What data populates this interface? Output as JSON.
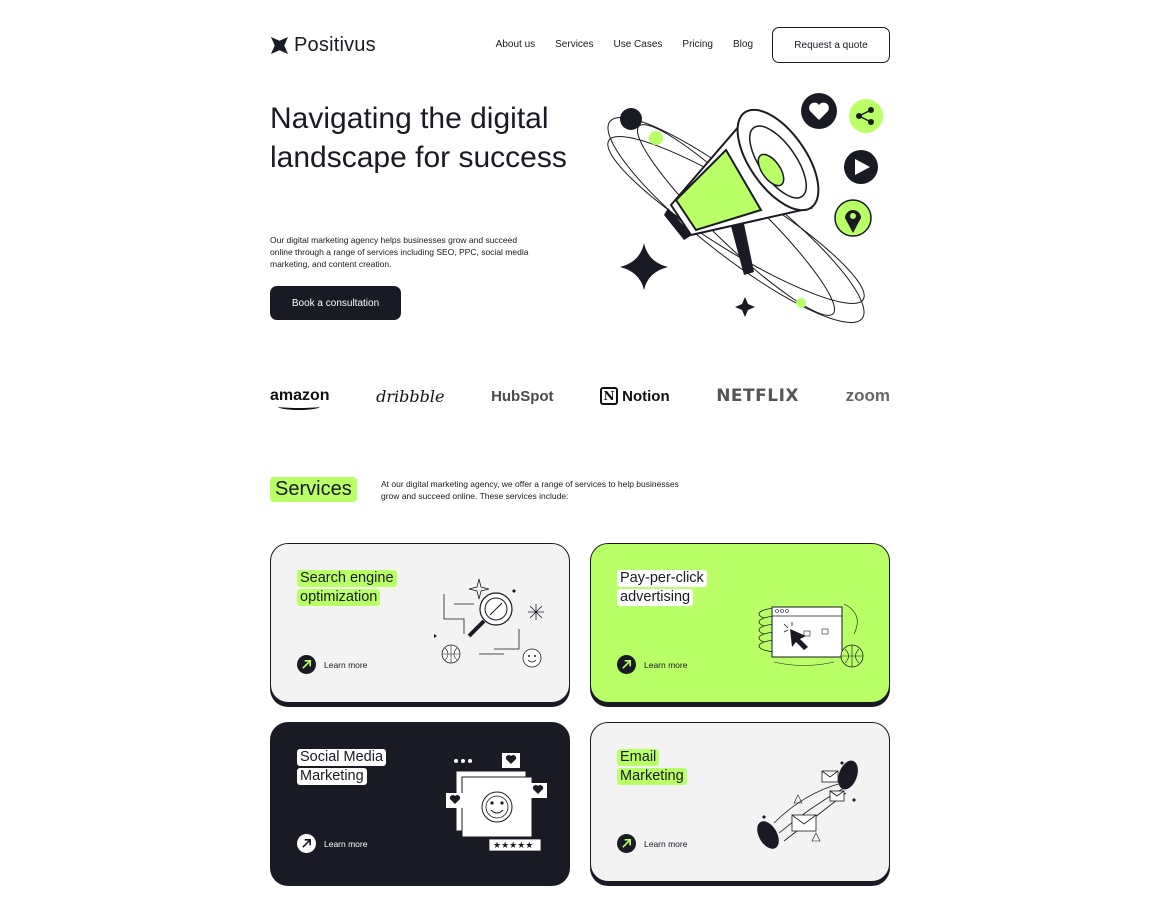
{
  "header": {
    "logo_text": "Positivus",
    "nav": [
      "About us",
      "Services",
      "Use Cases",
      "Pricing",
      "Blog"
    ],
    "cta_label": "Request a quote"
  },
  "hero": {
    "title": "Navigating the digital landscape for success",
    "description": "Our digital marketing agency helps businesses grow and succeed online through a range of services including SEO, PPC, social media marketing, and content creation.",
    "cta_label": "Book a consultation"
  },
  "brands": [
    "amazon",
    "dribbble",
    "HubSpot",
    "Notion",
    "NETFLIX",
    "zoom"
  ],
  "services": {
    "title": "Services",
    "description": "At our digital marketing agency, we offer a range of services to help businesses grow and succeed online. These services include:",
    "cards": [
      {
        "title_lines": [
          "Search engine",
          "optimization"
        ],
        "learn_more": "Learn more"
      },
      {
        "title_lines": [
          "Pay-per-click",
          "advertising"
        ],
        "learn_more": "Learn more"
      },
      {
        "title_lines": [
          "Social Media",
          "Marketing"
        ],
        "learn_more": "Learn more"
      },
      {
        "title_lines": [
          "Email",
          "Marketing"
        ],
        "learn_more": "Learn more"
      }
    ]
  },
  "colors": {
    "accent": "#B9FF66",
    "dark": "#191A23",
    "gray": "#F3F3F3"
  },
  "icons": {
    "hero": [
      "megaphone-icon",
      "heart-icon",
      "share-icon",
      "play-icon",
      "location-pin-icon",
      "sparkle-icon"
    ],
    "cards": [
      "magnifier-icon",
      "browser-cursor-icon",
      "smiley-window-icon",
      "envelope-flow-icon"
    ],
    "learn_more": "arrow-up-right-icon"
  }
}
